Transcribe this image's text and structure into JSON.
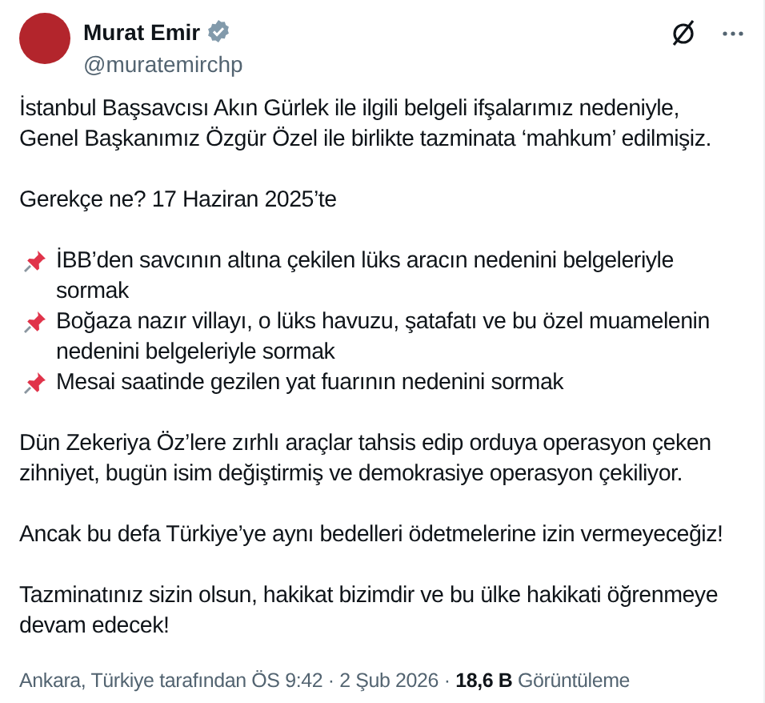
{
  "author": {
    "name": "Murat Emir",
    "verified": true,
    "handle": "@muratemirchp"
  },
  "paragraphs": [
    {
      "kind": "text",
      "text": "İstanbul Başsavcısı Akın Gürlek ile ilgili belgeli ifşalarımız nedeniyle, Genel Başkanımız Özgür Özel ile birlikte tazminata ‘mahkum’ edilmişiz."
    },
    {
      "kind": "text",
      "text": "Gerekçe ne? 17 Haziran 2025’te"
    },
    {
      "kind": "list",
      "items": [
        "İBB’den savcının altına çekilen lüks aracın nedenini belgeleriyle sormak",
        "Boğaza nazır villayı, o lüks havuzu, şatafatı ve bu özel muamelenin nedenini belgeleriyle sormak",
        "Mesai saatinde gezilen yat fuarının nedenini sormak"
      ]
    },
    {
      "kind": "text",
      "text": "Dün Zekeriya Öz’lere zırhlı araçlar tahsis edip orduya operasyon çeken zihniyet, bugün isim değiştirmiş ve demokrasiye operasyon çekiliyor."
    },
    {
      "kind": "text",
      "text": "Ancak bu defa Türkiye’ye aynı bedelleri ödetmelerine izin vermeyeceğiz!"
    },
    {
      "kind": "text",
      "text": "Tazminatınız sizin olsun, hakikat bizimdir ve bu ülke hakikati öğrenmeye devam edecek!"
    }
  ],
  "footer": "Ankara, Türkiye tarafından ÖS 9:42 · 2 Şub 2026 · **18,6 B** Görüntüleme"
}
